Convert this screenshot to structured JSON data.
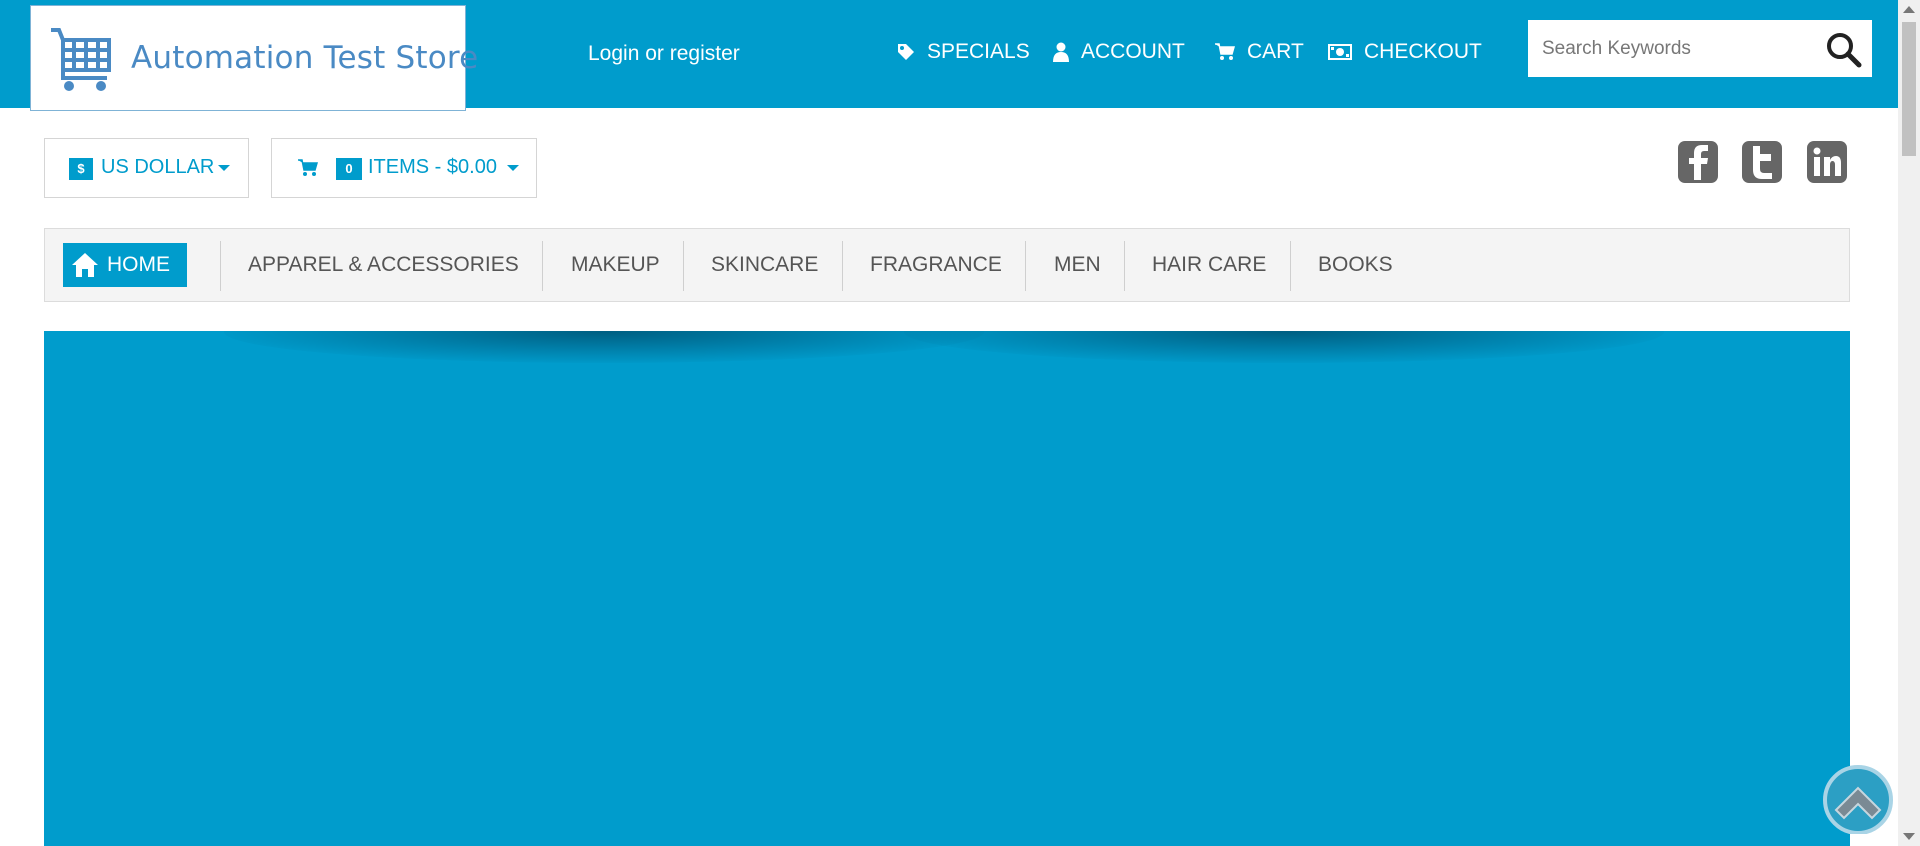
{
  "header": {
    "logo_text": "Automation Test Store",
    "login_label": "Login or register",
    "nav": [
      {
        "label": "SPECIALS",
        "icon": "tag-icon"
      },
      {
        "label": "ACCOUNT",
        "icon": "user-icon"
      },
      {
        "label": "CART",
        "icon": "cart-icon"
      },
      {
        "label": "CHECKOUT",
        "icon": "money-icon"
      }
    ],
    "search_placeholder": "Search Keywords"
  },
  "toolbar": {
    "currency_symbol": "$",
    "currency_label": "US DOLLAR",
    "cart_count": "0",
    "cart_summary": "ITEMS - $0.00"
  },
  "social": [
    "facebook-icon",
    "twitter-icon",
    "linkedin-icon"
  ],
  "categories": {
    "home": "HOME",
    "items": [
      "APPAREL & ACCESSORIES",
      "MAKEUP",
      "SKINCARE",
      "FRAGRANCE",
      "MEN",
      "HAIR CARE",
      "BOOKS"
    ]
  },
  "colors": {
    "brand": "#009ccc",
    "logo_text": "#4a8ac4",
    "category_text": "#555555"
  }
}
